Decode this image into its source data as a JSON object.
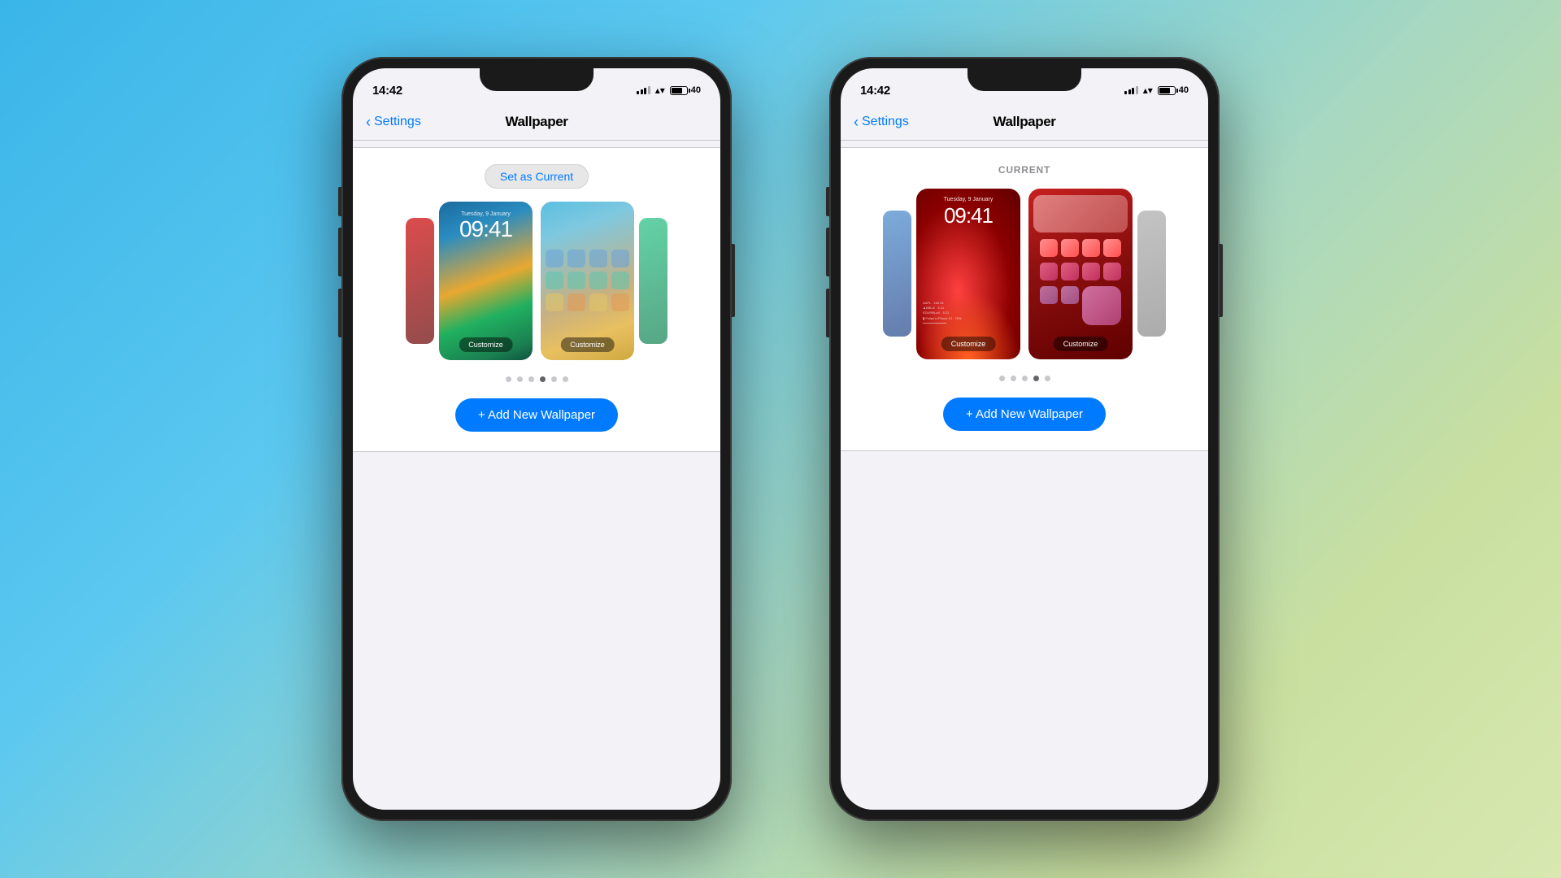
{
  "background": {
    "gradient": "linear-gradient(135deg, #3ab5e8 0%, #5bc8f0 30%, #a8d8c0 60%, #c8dfa0 80%, #d8e8b0 100%)"
  },
  "phones": [
    {
      "id": "phone-left",
      "status_bar": {
        "time": "14:42",
        "battery": "40"
      },
      "nav": {
        "back_label": "Settings",
        "title": "Wallpaper"
      },
      "card": {
        "set_as_current_label": "Set as Current",
        "label": null,
        "current": false
      },
      "dots": [
        false,
        false,
        false,
        true,
        false,
        false
      ],
      "add_button_label": "+ Add New Wallpaper",
      "customize_label": "Customize"
    },
    {
      "id": "phone-right",
      "status_bar": {
        "time": "14:42",
        "battery": "40"
      },
      "nav": {
        "back_label": "Settings",
        "title": "Wallpaper"
      },
      "card": {
        "set_as_current_label": null,
        "label": "CURRENT",
        "current": true
      },
      "dots": [
        false,
        false,
        false,
        true,
        false
      ],
      "add_button_label": "+ Add New Wallpaper",
      "customize_label": "Customize"
    }
  ]
}
